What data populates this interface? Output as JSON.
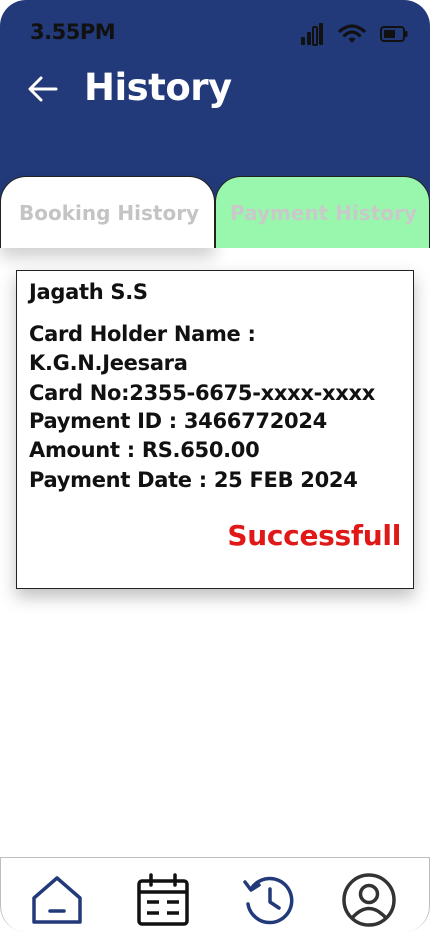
{
  "status_bar": {
    "time": "3.55PM"
  },
  "header": {
    "title": "History"
  },
  "tabs": [
    {
      "label": "Booking History"
    },
    {
      "label": "Payment History"
    }
  ],
  "payment_card": {
    "name": "Jagath S.S",
    "card_holder_label": "Card Holder Name :",
    "card_holder_value": "K.G.N.Jeesara",
    "card_no": "Card No:2355-6675-xxxx-xxxx",
    "payment_id": "Payment ID : 3466772024",
    "amount": "Amount : RS.650.00",
    "payment_date": "Payment Date : 25 FEB 2024",
    "status": "Successfull"
  },
  "colors": {
    "header_bg": "#233a7a",
    "active_tab_bg": "#98f7ad",
    "status_success": "#e01818"
  },
  "bottom_nav": {
    "items": [
      "home-icon",
      "calendar-icon",
      "history-icon",
      "profile-icon"
    ]
  }
}
